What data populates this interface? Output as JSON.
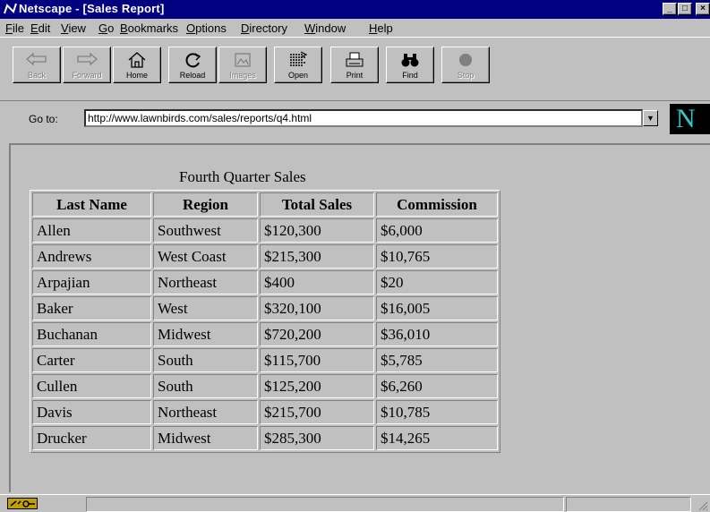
{
  "window": {
    "title": "Netscape - [Sales Report]",
    "controls": {
      "minimize": "_",
      "maximize": "□",
      "close": "×"
    }
  },
  "menu": [
    {
      "label": "File",
      "accel": "F"
    },
    {
      "label": "Edit",
      "accel": "E"
    },
    {
      "label": "View",
      "accel": "V"
    },
    {
      "label": "Go",
      "accel": "G"
    },
    {
      "label": "Bookmarks",
      "accel": "B"
    },
    {
      "label": "Options",
      "accel": "O"
    },
    {
      "label": "Directory",
      "accel": "D"
    },
    {
      "label": "Window",
      "accel": "W"
    },
    {
      "label": "Help",
      "accel": "H"
    }
  ],
  "toolbar": {
    "back": "Back",
    "forward": "Forward",
    "home": "Home",
    "reload": "Reload",
    "images": "Images",
    "open": "Open",
    "print": "Print",
    "find": "Find",
    "stop": "Stop"
  },
  "location": {
    "label": "Go to:",
    "url": "http://www.lawnbirds.com/sales/reports/q4.html",
    "logo": "N"
  },
  "report": {
    "caption": "Fourth Quarter Sales",
    "headers": [
      "Last Name",
      "Region",
      "Total Sales",
      "Commission"
    ],
    "rows": [
      [
        "Allen",
        "Southwest",
        "$120,300",
        "$6,000"
      ],
      [
        "Andrews",
        "West Coast",
        "$215,300",
        "$10,765"
      ],
      [
        "Arpajian",
        "Northeast",
        "$400",
        "$20"
      ],
      [
        "Baker",
        "West",
        "$320,100",
        "$16,005"
      ],
      [
        "Buchanan",
        "Midwest",
        "$720,200",
        "$36,010"
      ],
      [
        "Carter",
        "South",
        "$115,700",
        "$5,785"
      ],
      [
        "Cullen",
        "South",
        "$125,200",
        "$6,260"
      ],
      [
        "Davis",
        "Northeast",
        "$215,700",
        "$10,785"
      ],
      [
        "Drucker",
        "Midwest",
        "$285,300",
        "$14,265"
      ]
    ]
  },
  "colors": {
    "title_bar": "#000080",
    "chrome": "#c0c0c0",
    "logo_text": "#2ec9c9"
  }
}
